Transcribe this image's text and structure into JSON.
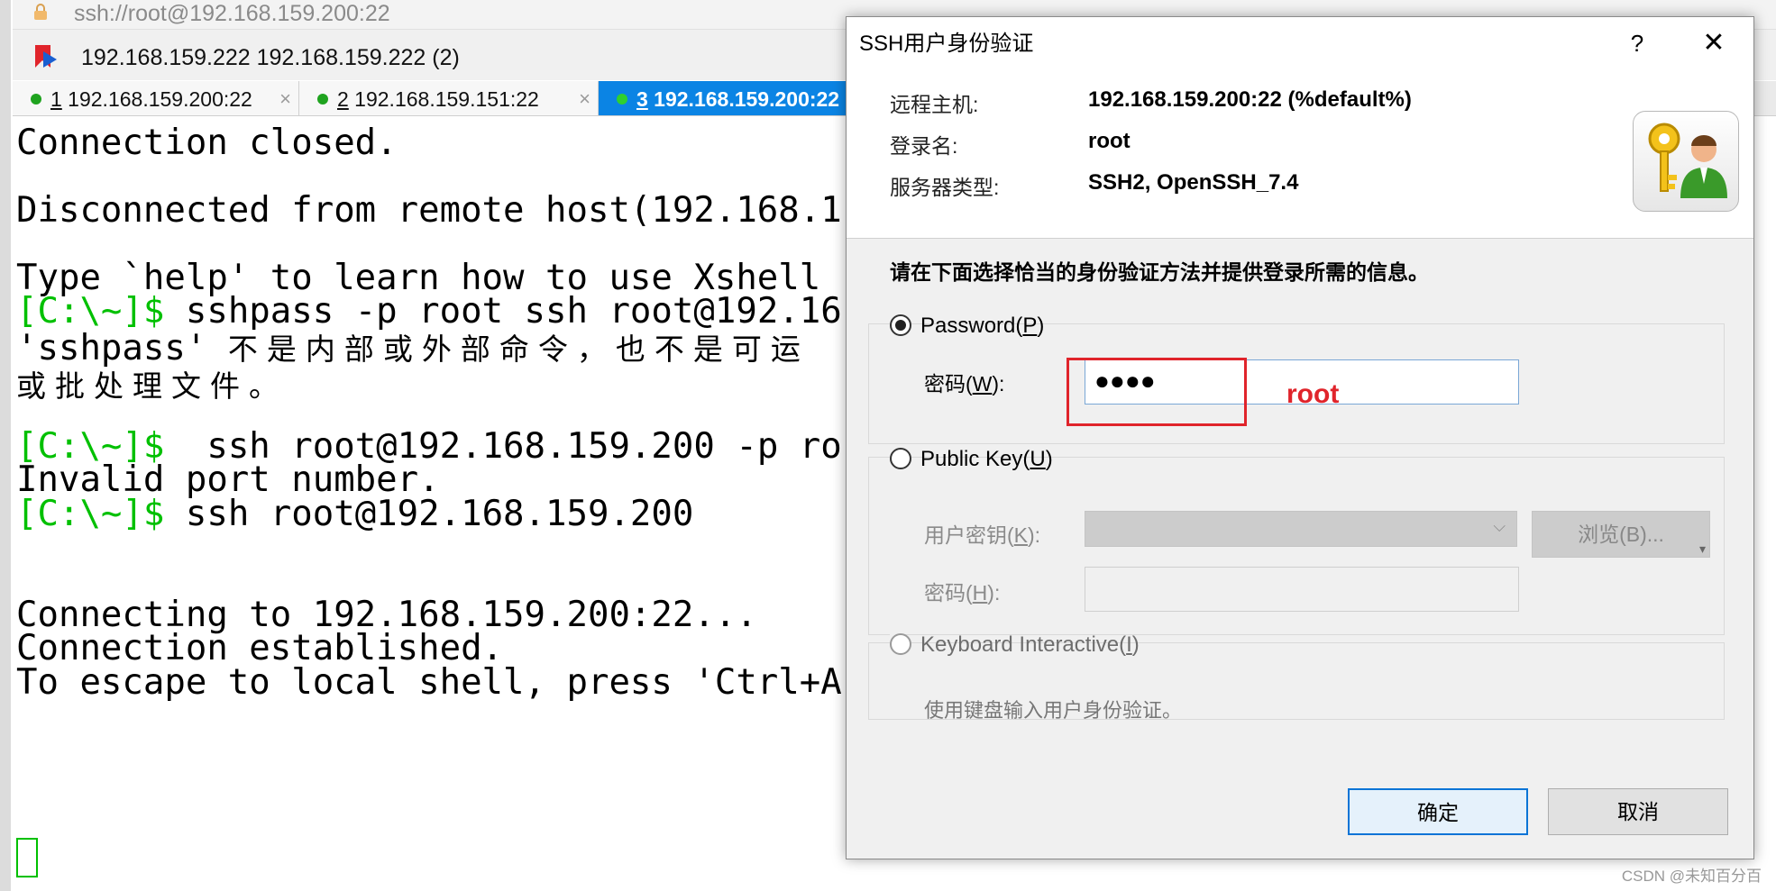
{
  "terminal_window": {
    "address": "ssh://root@192.168.159.200:22",
    "session_path": "192.168.159.222  192.168.159.222 (2)",
    "tabs": [
      {
        "num": "1",
        "title": " 192.168.159.200:22",
        "close": "×",
        "active": false
      },
      {
        "num": "2",
        "title": " 192.168.159.151:22",
        "close": "×",
        "active": false
      },
      {
        "num": "3",
        "title": " 192.168.159.200:22",
        "close": "",
        "active": true
      }
    ],
    "lines": [
      {
        "prompt": "",
        "text": "Connection closed."
      },
      {
        "prompt": "",
        "text": "Disconnected from remote host(192.168.1"
      },
      {
        "prompt": "",
        "text": "Type `help' to learn how to use Xshell"
      },
      {
        "prompt": "[C:\\~]$",
        "text": " sshpass -p root ssh root@192.16"
      },
      {
        "prompt": "",
        "text": "'sshpass' "
      },
      {
        "prompt": "",
        "text": "不是内部或外部命令，也不是可运"
      },
      {
        "prompt": "",
        "text": "或批处理文件。"
      },
      {
        "prompt": "[C:\\~]$",
        "text": "  ssh root@192.168.159.200 -p ro"
      },
      {
        "prompt": "",
        "text": "Invalid port number."
      },
      {
        "prompt": "[C:\\~]$",
        "text": " ssh root@192.168.159.200"
      },
      {
        "prompt": "",
        "text": "Connecting to 192.168.159.200:22..."
      },
      {
        "prompt": "",
        "text": "Connection established."
      },
      {
        "prompt": "",
        "text": "To escape to local shell, press 'Ctrl+A"
      }
    ],
    "watermark": "CSDN @未知百分百"
  },
  "dialog": {
    "title": "SSH用户身份验证",
    "help": "?",
    "close": "✕",
    "remote_host_label": "远程主机:",
    "remote_host_value": "192.168.159.200:22 (%default%)",
    "login_label": "登录名:",
    "login_value": "root",
    "server_type_label": "服务器类型:",
    "server_type_value": "SSH2, OpenSSH_7.4",
    "instruction": "请在下面选择恰当的身份验证方法并提供登录所需的信息。",
    "password_method": {
      "label": "Password(",
      "mnemonic": "P",
      "end": ")",
      "field_label": "密码(",
      "field_mnemonic": "W",
      "field_end": "):",
      "value": "●●●●",
      "annotation": "root"
    },
    "publickey_method": {
      "label": "Public Key(",
      "mnemonic": "U",
      "end": ")",
      "key_label": "用户密钥(",
      "key_mnemonic": "K",
      "key_end": "):",
      "browse": "浏览(B)...",
      "pass_label": "密码(",
      "pass_mnemonic": "H",
      "pass_end": "):"
    },
    "keyboard_method": {
      "label": "Keyboard Interactive(",
      "mnemonic": "I",
      "end": ")",
      "hint": "使用键盘输入用户身份验证。"
    },
    "ok": "确定",
    "cancel": "取消"
  },
  "colors": {
    "prompt_green": "#00c000",
    "tab_active": "#0b84e4",
    "annotation_red": "#e0242b"
  }
}
